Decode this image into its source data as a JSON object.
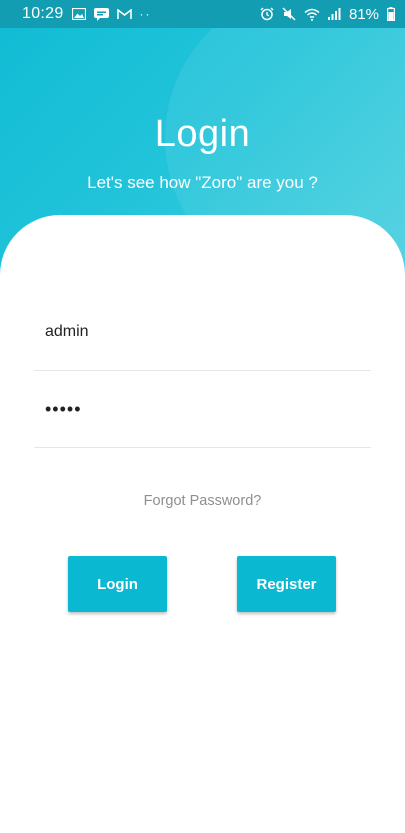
{
  "status_bar": {
    "time": "10:29",
    "battery": "81%",
    "overflow_dots": "··",
    "left_icons": [
      "image-icon",
      "chat-icon",
      "gmail-icon"
    ],
    "right_icons": [
      "alarm-icon",
      "mute-icon",
      "wifi-icon",
      "signal-icon",
      "battery-icon"
    ]
  },
  "header": {
    "title": "Login",
    "subtitle": "Let's see how \"Zoro\" are you ?"
  },
  "form": {
    "username_value": "admin",
    "password_value": "admin"
  },
  "links": {
    "forgot_password": "Forgot Password?"
  },
  "buttons": {
    "login": "Login",
    "register": "Register"
  },
  "colors": {
    "accent": "#0ab8d2",
    "status_bar": "#139db3",
    "header_gradient_start": "#11bcd4",
    "header_gradient_end": "#4fd1e0",
    "muted_text": "#8f8f8f"
  }
}
